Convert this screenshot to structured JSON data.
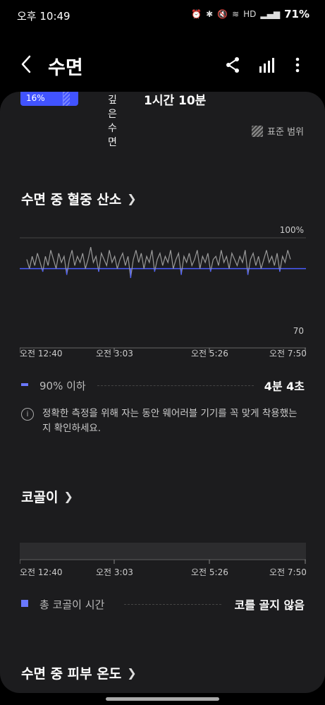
{
  "status": {
    "time": "오후 10:49",
    "hd_label": "HD",
    "battery": "71%"
  },
  "app_bar": {
    "title": "수면"
  },
  "deep_sleep": {
    "percent": "16%",
    "label": "깊은 수면",
    "value": "1시간 10분"
  },
  "standard_range_label": "표준 범위",
  "spo2": {
    "title": "수면 중 혈중 산소",
    "y_max_label": "100%",
    "y_min_label": "70",
    "x_labels": [
      "오전 12:40",
      "오전 3:03",
      "오전 5:26",
      "오전 7:50"
    ],
    "legend_label": "90% 이하",
    "legend_value": "4분 4초",
    "info": "정확한 측정을 위해 자는 동안 웨어러블 기기를 꼭 맞게 착용했는지 확인하세요."
  },
  "snoring": {
    "title": "코골이",
    "x_labels": [
      "오전 12:40",
      "오전 3:03",
      "오전 5:26",
      "오전 7:50"
    ],
    "legend_label": "총 코골이 시간",
    "legend_value": "코를 골지 않음"
  },
  "skin_temp": {
    "title": "수면 중 피부 온도"
  },
  "chart_data": {
    "type": "line",
    "title": "수면 중 혈중 산소",
    "x_range": [
      "오전 12:40",
      "오전 7:50"
    ],
    "ylim": [
      70,
      100
    ],
    "reference_line": 90,
    "series": [
      {
        "values": [
          93,
          90,
          94,
          91,
          95,
          92,
          89,
          94,
          91,
          96,
          93,
          90,
          95,
          92,
          94,
          88,
          93,
          96,
          91,
          94,
          92,
          95,
          90,
          93,
          97,
          92,
          94,
          89,
          95,
          93,
          91,
          96,
          92,
          94,
          90,
          93,
          95,
          91,
          94,
          87,
          93,
          96,
          92,
          95,
          90,
          94,
          92,
          96,
          89,
          93,
          95,
          91,
          94,
          92,
          96,
          90,
          93,
          95,
          88,
          94,
          92,
          95,
          91,
          93,
          96,
          90,
          94,
          92,
          95,
          89,
          93,
          94,
          91,
          96,
          92,
          94,
          90,
          95,
          93,
          91,
          94,
          92,
          96,
          88,
          93,
          95,
          91,
          94,
          90,
          93,
          96,
          92,
          94,
          91,
          95,
          89,
          94,
          92,
          96,
          93
        ]
      }
    ],
    "colors": {
      "line": "#9a9a9a",
      "reference": "#4a5cff"
    }
  },
  "colors": {
    "accent": "#4153ff",
    "card_bg": "#1c1c1e",
    "page_bg": "#000000"
  }
}
